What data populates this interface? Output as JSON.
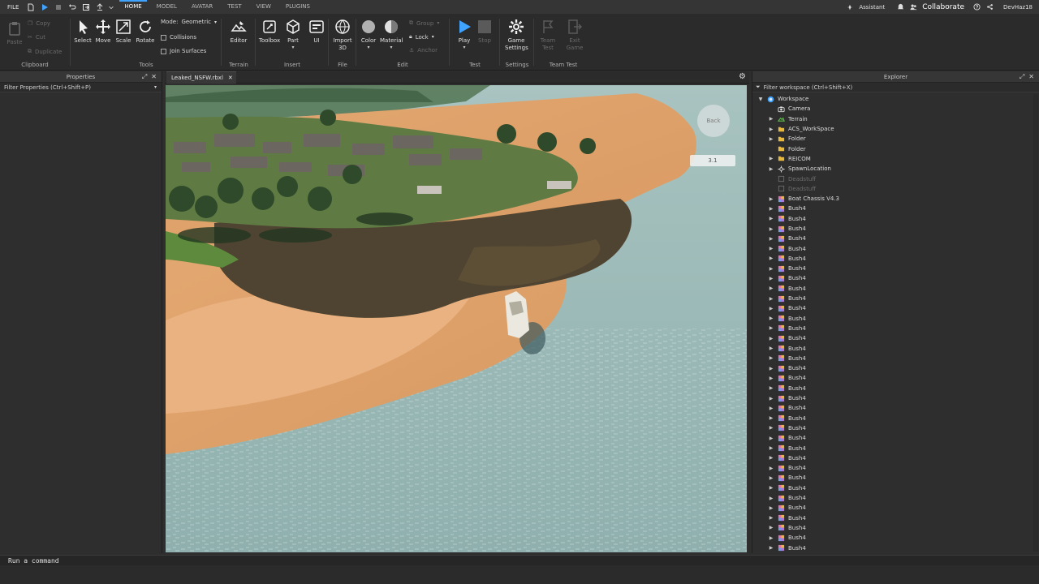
{
  "menubar": {
    "file": "FILE",
    "tabs": [
      "HOME",
      "MODEL",
      "AVATAR",
      "TEST",
      "VIEW",
      "PLUGINS"
    ],
    "active_tab": "HOME",
    "assistant": "Assistant",
    "collaborate": "Collaborate",
    "username": "DevHaz18"
  },
  "ribbon": {
    "clipboard": {
      "paste": "Paste",
      "copy": "Copy",
      "cut": "Cut",
      "duplicate": "Duplicate",
      "label": "Clipboard"
    },
    "tools": {
      "select": "Select",
      "move": "Move",
      "scale": "Scale",
      "rotate": "Rotate",
      "mode_label": "Mode:",
      "mode_value": "Geometric",
      "collisions": "Collisions",
      "join_surfaces": "Join Surfaces",
      "label": "Tools"
    },
    "terrain": {
      "editor": "Editor",
      "label": "Terrain"
    },
    "insert": {
      "toolbox": "Toolbox",
      "part": "Part",
      "ui": "UI",
      "label": "Insert"
    },
    "file": {
      "import3d_line1": "Import",
      "import3d_line2": "3D",
      "label": "File"
    },
    "edit": {
      "color": "Color",
      "material": "Material",
      "group": "Group",
      "lock": "Lock",
      "anchor": "Anchor",
      "label": "Edit"
    },
    "test": {
      "play": "Play",
      "stop": "Stop",
      "label": "Test"
    },
    "settings": {
      "game_line1": "Game",
      "game_line2": "Settings",
      "label": "Settings"
    },
    "team_test": {
      "team_line1": "Team",
      "team_line2": "Test",
      "exit_line1": "Exit",
      "exit_line2": "Game",
      "label": "Team Test"
    }
  },
  "properties": {
    "title": "Properties",
    "filter": "Filter Properties (Ctrl+Shift+P)"
  },
  "document": {
    "tab_name": "Leaked_NSFW.rbxl"
  },
  "viewport": {
    "gizmo_label": "Back",
    "readout": "3.1"
  },
  "explorer": {
    "title": "Explorer",
    "filter": "Filter workspace (Ctrl+Shift+X)",
    "items": [
      {
        "name": "Workspace",
        "indent": 0,
        "icon": "workspace-icon",
        "arrow": "down",
        "dim": false
      },
      {
        "name": "Camera",
        "indent": 1,
        "icon": "camera-icon",
        "arrow": "none",
        "dim": false
      },
      {
        "name": "Terrain",
        "indent": 1,
        "icon": "terrain-icon",
        "arrow": "right",
        "dim": false
      },
      {
        "name": "ACS_WorkSpace",
        "indent": 1,
        "icon": "folder-icon",
        "arrow": "right",
        "dim": false
      },
      {
        "name": "Folder",
        "indent": 1,
        "icon": "folder-icon",
        "arrow": "right",
        "dim": false
      },
      {
        "name": "Folder",
        "indent": 1,
        "icon": "folder-icon",
        "arrow": "none",
        "dim": false
      },
      {
        "name": "REICOM",
        "indent": 1,
        "icon": "folder-icon",
        "arrow": "right",
        "dim": false
      },
      {
        "name": "SpawnLocation",
        "indent": 1,
        "icon": "spawn-icon",
        "arrow": "right",
        "dim": false
      },
      {
        "name": "Deadstuff",
        "indent": 1,
        "icon": "part-icon",
        "arrow": "none",
        "dim": true
      },
      {
        "name": "Deadstuff",
        "indent": 1,
        "icon": "part-icon",
        "arrow": "none",
        "dim": true
      },
      {
        "name": "Boat Chassis V4.3",
        "indent": 1,
        "icon": "model-icon",
        "arrow": "right",
        "dim": false
      },
      {
        "name": "Bush4",
        "indent": 1,
        "icon": "model-icon",
        "arrow": "right",
        "dim": false
      },
      {
        "name": "Bush4",
        "indent": 1,
        "icon": "model-icon",
        "arrow": "right",
        "dim": false
      },
      {
        "name": "Bush4",
        "indent": 1,
        "icon": "model-icon",
        "arrow": "right",
        "dim": false
      },
      {
        "name": "Bush4",
        "indent": 1,
        "icon": "model-icon",
        "arrow": "right",
        "dim": false
      },
      {
        "name": "Bush4",
        "indent": 1,
        "icon": "model-icon",
        "arrow": "right",
        "dim": false
      },
      {
        "name": "Bush4",
        "indent": 1,
        "icon": "model-icon",
        "arrow": "right",
        "dim": false
      },
      {
        "name": "Bush4",
        "indent": 1,
        "icon": "model-icon",
        "arrow": "right",
        "dim": false
      },
      {
        "name": "Bush4",
        "indent": 1,
        "icon": "model-icon",
        "arrow": "right",
        "dim": false
      },
      {
        "name": "Bush4",
        "indent": 1,
        "icon": "model-icon",
        "arrow": "right",
        "dim": false
      },
      {
        "name": "Bush4",
        "indent": 1,
        "icon": "model-icon",
        "arrow": "right",
        "dim": false
      },
      {
        "name": "Bush4",
        "indent": 1,
        "icon": "model-icon",
        "arrow": "right",
        "dim": false
      },
      {
        "name": "Bush4",
        "indent": 1,
        "icon": "model-icon",
        "arrow": "right",
        "dim": false
      },
      {
        "name": "Bush4",
        "indent": 1,
        "icon": "model-icon",
        "arrow": "right",
        "dim": false
      },
      {
        "name": "Bush4",
        "indent": 1,
        "icon": "model-icon",
        "arrow": "right",
        "dim": false
      },
      {
        "name": "Bush4",
        "indent": 1,
        "icon": "model-icon",
        "arrow": "right",
        "dim": false
      },
      {
        "name": "Bush4",
        "indent": 1,
        "icon": "model-icon",
        "arrow": "right",
        "dim": false
      },
      {
        "name": "Bush4",
        "indent": 1,
        "icon": "model-icon",
        "arrow": "right",
        "dim": false
      },
      {
        "name": "Bush4",
        "indent": 1,
        "icon": "model-icon",
        "arrow": "right",
        "dim": false
      },
      {
        "name": "Bush4",
        "indent": 1,
        "icon": "model-icon",
        "arrow": "right",
        "dim": false
      },
      {
        "name": "Bush4",
        "indent": 1,
        "icon": "model-icon",
        "arrow": "right",
        "dim": false
      },
      {
        "name": "Bush4",
        "indent": 1,
        "icon": "model-icon",
        "arrow": "right",
        "dim": false
      },
      {
        "name": "Bush4",
        "indent": 1,
        "icon": "model-icon",
        "arrow": "right",
        "dim": false
      },
      {
        "name": "Bush4",
        "indent": 1,
        "icon": "model-icon",
        "arrow": "right",
        "dim": false
      },
      {
        "name": "Bush4",
        "indent": 1,
        "icon": "model-icon",
        "arrow": "right",
        "dim": false
      },
      {
        "name": "Bush4",
        "indent": 1,
        "icon": "model-icon",
        "arrow": "right",
        "dim": false
      },
      {
        "name": "Bush4",
        "indent": 1,
        "icon": "model-icon",
        "arrow": "right",
        "dim": false
      },
      {
        "name": "Bush4",
        "indent": 1,
        "icon": "model-icon",
        "arrow": "right",
        "dim": false
      },
      {
        "name": "Bush4",
        "indent": 1,
        "icon": "model-icon",
        "arrow": "right",
        "dim": false
      },
      {
        "name": "Bush4",
        "indent": 1,
        "icon": "model-icon",
        "arrow": "right",
        "dim": false
      },
      {
        "name": "Bush4",
        "indent": 1,
        "icon": "model-icon",
        "arrow": "right",
        "dim": false
      },
      {
        "name": "Bush4",
        "indent": 1,
        "icon": "model-icon",
        "arrow": "right",
        "dim": false
      },
      {
        "name": "Bush4",
        "indent": 1,
        "icon": "model-icon",
        "arrow": "right",
        "dim": false
      },
      {
        "name": "Bush4",
        "indent": 1,
        "icon": "model-icon",
        "arrow": "right",
        "dim": false
      },
      {
        "name": "Bush4",
        "indent": 1,
        "icon": "model-icon",
        "arrow": "right",
        "dim": false
      },
      {
        "name": "Bush4",
        "indent": 1,
        "icon": "model-icon",
        "arrow": "right",
        "dim": false
      }
    ]
  },
  "command_bar": {
    "placeholder": "Run a command"
  },
  "colors": {
    "accent": "#3fa3ff",
    "panel": "#2e2e2e",
    "ribbon": "#2b2b2b",
    "folder": "#e8b93a",
    "terrain": "#5fbf4a",
    "play": "#3fa3ff"
  }
}
